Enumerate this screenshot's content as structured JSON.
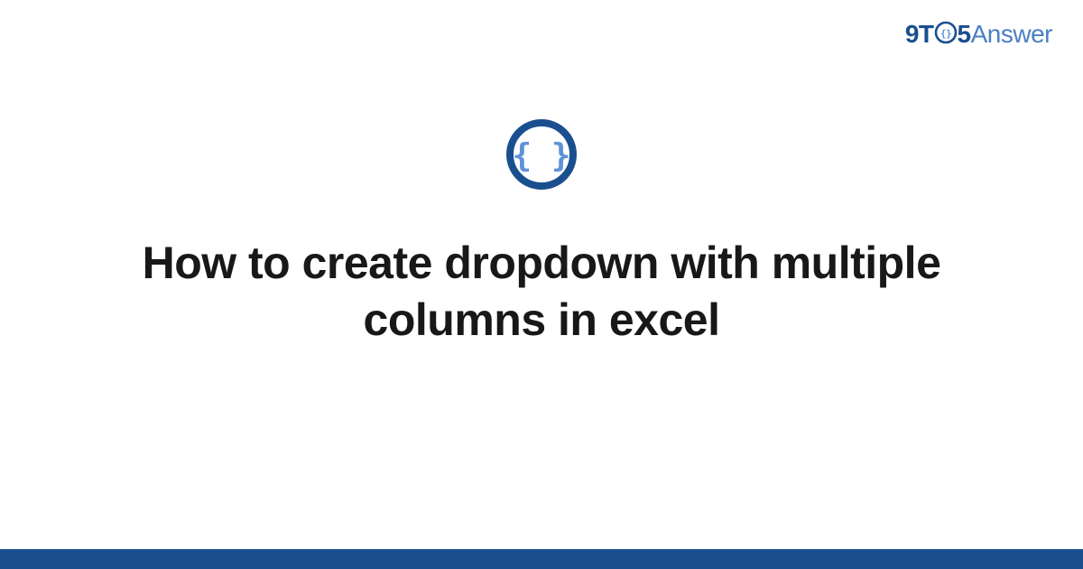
{
  "logo": {
    "pre": "9T",
    "post": "5",
    "suffix": "Answer"
  },
  "title": "How to create dropdown with multiple columns in excel",
  "colors": {
    "brand_dark": "#1a4f8f",
    "brand_light": "#4a7fc4",
    "icon_inner": "#5f93d8",
    "text": "#18181b"
  }
}
